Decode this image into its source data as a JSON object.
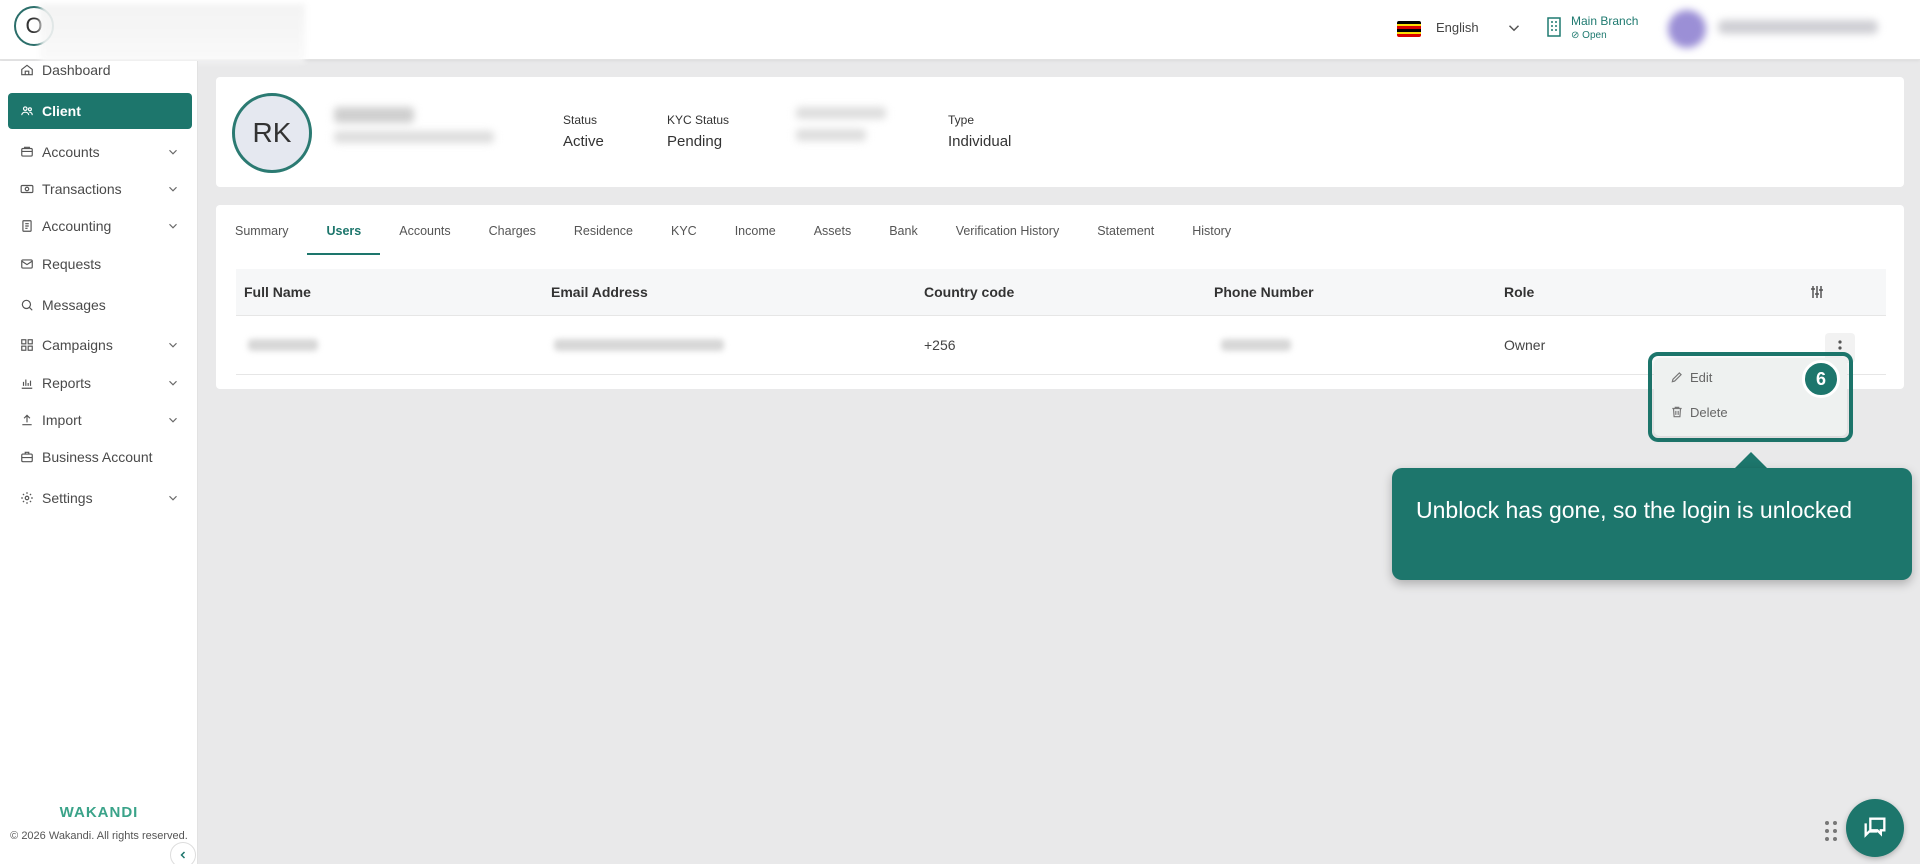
{
  "topbar": {
    "language": "English",
    "branch_name": "Main Branch",
    "branch_status": "Open"
  },
  "sidebar": {
    "items": [
      {
        "label": "Dashboard",
        "icon": "home-icon",
        "expandable": false
      },
      {
        "label": "Client",
        "icon": "users-icon",
        "expandable": false,
        "active": true
      },
      {
        "label": "Accounts",
        "icon": "accounts-icon",
        "expandable": true
      },
      {
        "label": "Transactions",
        "icon": "transactions-icon",
        "expandable": true
      },
      {
        "label": "Accounting",
        "icon": "ledger-icon",
        "expandable": true
      },
      {
        "label": "Requests",
        "icon": "mail-icon",
        "expandable": false
      },
      {
        "label": "Messages",
        "icon": "message-icon",
        "expandable": false
      },
      {
        "label": "Campaigns",
        "icon": "grid-icon",
        "expandable": true
      },
      {
        "label": "Reports",
        "icon": "bar-chart-icon",
        "expandable": true
      },
      {
        "label": "Import",
        "icon": "upload-icon",
        "expandable": true
      },
      {
        "label": "Business Account",
        "icon": "briefcase-icon",
        "expandable": false
      },
      {
        "label": "Settings",
        "icon": "gear-icon",
        "expandable": true
      }
    ],
    "brand": "WAKANDI",
    "copyright": "© 2026 Wakandi. All rights reserved."
  },
  "client": {
    "initials": "RK",
    "status_label": "Status",
    "status_value": "Active",
    "kyc_label": "KYC Status",
    "kyc_value": "Pending",
    "type_label": "Type",
    "type_value": "Individual"
  },
  "tabs": [
    "Summary",
    "Users",
    "Accounts",
    "Charges",
    "Residence",
    "KYC",
    "Income",
    "Assets",
    "Bank",
    "Verification History",
    "Statement",
    "History"
  ],
  "active_tab": "Users",
  "table": {
    "columns": [
      "Full Name",
      "Email Address",
      "Country code",
      "Phone Number",
      "Role"
    ],
    "rows": [
      {
        "country_code": "+256",
        "role": "Owner"
      }
    ]
  },
  "menu": {
    "edit": "Edit",
    "delete": "Delete"
  },
  "guide": {
    "step": "6",
    "message": "Unblock has gone, so the login is unlocked"
  },
  "colors": {
    "primary": "#1d766c",
    "brand": "#3aa389",
    "background": "#e9e9ea"
  }
}
